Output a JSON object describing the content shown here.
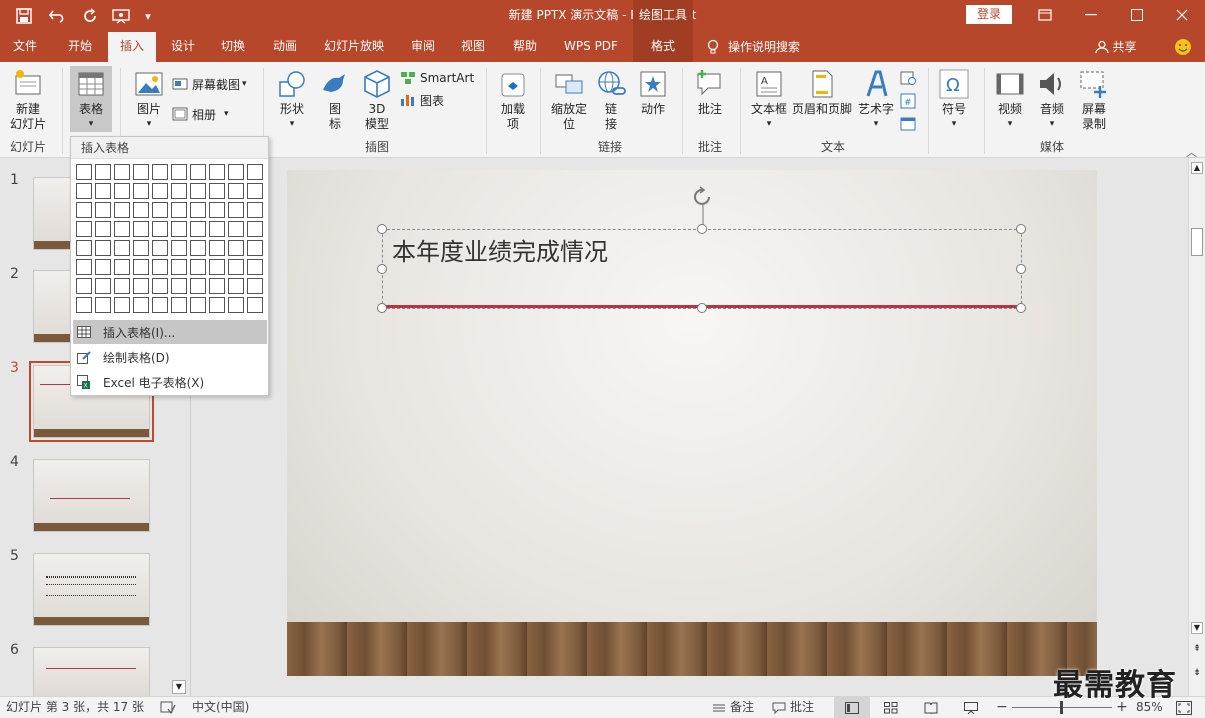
{
  "app": {
    "document_title": "新建 PPTX 演示文稿  -  PowerPoint",
    "context_tools_label": "绘图工具",
    "login_label": "登录"
  },
  "tabs": [
    {
      "label": "文件"
    },
    {
      "label": "开始"
    },
    {
      "label": "插入"
    },
    {
      "label": "设计"
    },
    {
      "label": "切换"
    },
    {
      "label": "动画"
    },
    {
      "label": "幻灯片放映"
    },
    {
      "label": "审阅"
    },
    {
      "label": "视图"
    },
    {
      "label": "帮助"
    },
    {
      "label": "WPS PDF"
    },
    {
      "label": "格式"
    }
  ],
  "tell_me": "操作说明搜索",
  "share": "共享",
  "ribbon": {
    "new_slide": "新建\n幻灯片",
    "table": "表格",
    "picture": "图片",
    "screenshot": "屏幕截图",
    "album": "相册",
    "shapes": "形状",
    "icons": "图\n标",
    "model3d": "3D\n模型",
    "smartart": "SmartArt",
    "chart": "图表",
    "addins": "加载\n项",
    "zoom": "缩放定\n位",
    "link": "链\n接",
    "action": "动作",
    "comment": "批注",
    "textbox": "文本框",
    "header_footer": "页眉和页脚",
    "wordart": "艺术字",
    "symbol": "符号",
    "video": "视频",
    "audio": "音频",
    "screen_record": "屏幕\n录制",
    "groups": {
      "slides": "幻灯片",
      "illustrations": "插图",
      "links": "链接",
      "comments": "批注",
      "text": "文本",
      "media": "媒体"
    }
  },
  "dropdown": {
    "header": "插入表格",
    "items": [
      {
        "label": "插入表格(I)..."
      },
      {
        "label": "绘制表格(D)"
      },
      {
        "label": "Excel 电子表格(X)"
      }
    ]
  },
  "thumbnails": [
    "1",
    "2",
    "3",
    "4",
    "5",
    "6"
  ],
  "slide": {
    "title": "本年度业绩完成情况"
  },
  "status": {
    "slide_info": "幻灯片 第 3 张，共 17 张",
    "language": "中文(中国)",
    "notes": "备注",
    "comments": "批注",
    "zoom": "85%"
  },
  "watermark": "最需教育"
}
